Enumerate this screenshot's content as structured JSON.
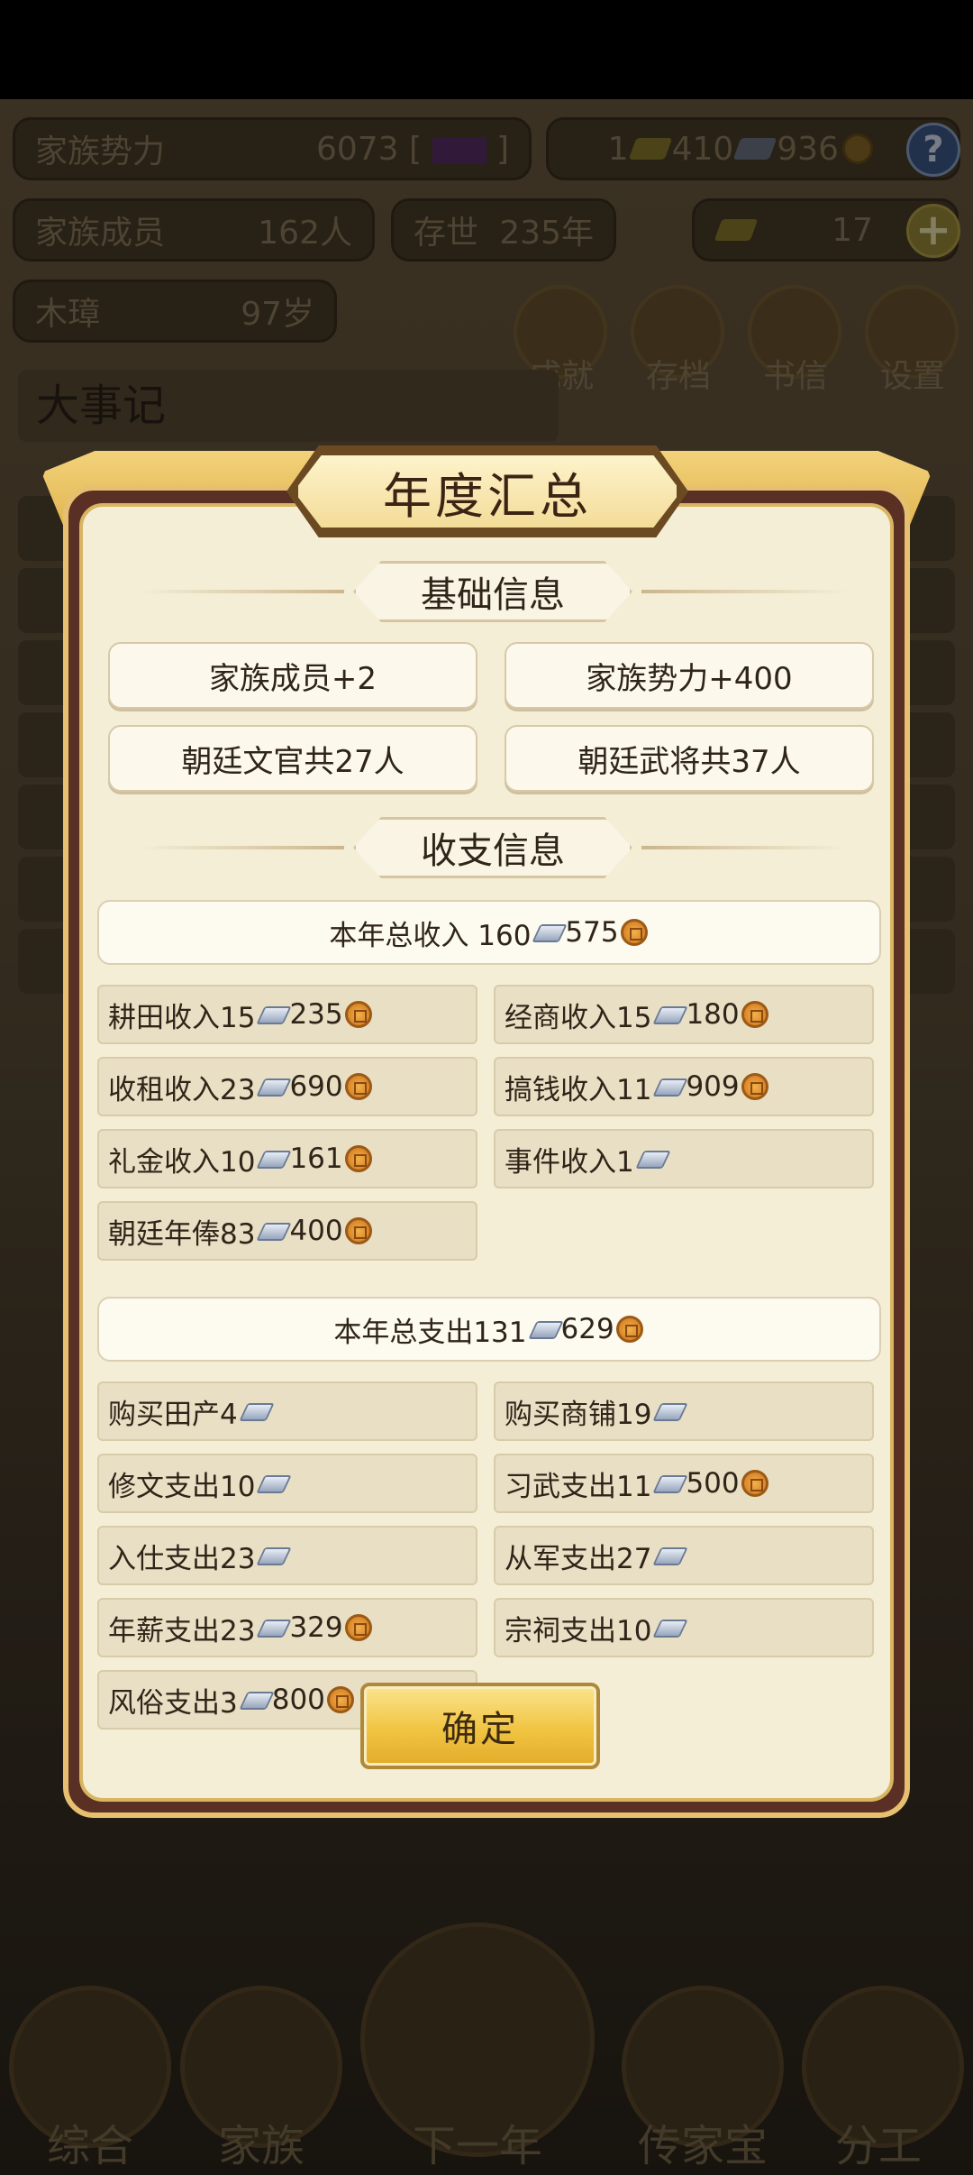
{
  "header": {
    "power_label": "家族势力",
    "power_value": "6073",
    "power_tag": "",
    "gold_ingots": "1",
    "silver": "410",
    "coins": "936",
    "members_label": "家族成员",
    "members_value": "162人",
    "years_label": "存世",
    "years_value": "235年",
    "yuanbao": "17",
    "patriarch_name": "木璋",
    "patriarch_age": "97岁"
  },
  "top_menu": [
    {
      "label": "成就"
    },
    {
      "label": "存档"
    },
    {
      "label": "书信"
    },
    {
      "label": "设置"
    }
  ],
  "events_title": "大事记",
  "bottom_nav": [
    {
      "label": "综合"
    },
    {
      "label": "家族"
    },
    {
      "label": "下一年"
    },
    {
      "label": "传家宝"
    },
    {
      "label": "分工"
    }
  ],
  "dialog": {
    "title": "年度汇总",
    "basic_section": "基础信息",
    "basic": [
      {
        "text": "家族成员+2"
      },
      {
        "text": "家族势力+400"
      },
      {
        "text": "朝廷文官共27人"
      },
      {
        "text": "朝廷武将共37人"
      }
    ],
    "finance_section": "收支信息",
    "income_total": {
      "label": "本年总收入 160",
      "coins": "575"
    },
    "income": [
      {
        "label": "耕田收入15",
        "coins": "235"
      },
      {
        "label": "经商收入15",
        "coins": "180"
      },
      {
        "label": "收租收入23",
        "coins": "690"
      },
      {
        "label": "搞钱收入11",
        "coins": "909"
      },
      {
        "label": "礼金收入10",
        "coins": "161"
      },
      {
        "label": "事件收入1",
        "coins": ""
      },
      {
        "label": "朝廷年俸83",
        "coins": "400"
      }
    ],
    "expense_total": {
      "label": "本年总支出131",
      "coins": "629"
    },
    "expense": [
      {
        "label": "购买田产4",
        "coins": ""
      },
      {
        "label": "购买商铺19",
        "coins": ""
      },
      {
        "label": "修文支出10",
        "coins": ""
      },
      {
        "label": "习武支出11",
        "coins": "500"
      },
      {
        "label": "入仕支出23",
        "coins": ""
      },
      {
        "label": "从军支出27",
        "coins": ""
      },
      {
        "label": "年薪支出23",
        "coins": "329"
      },
      {
        "label": "宗祠支出10",
        "coins": ""
      },
      {
        "label": "风俗支出3",
        "coins": "800"
      }
    ],
    "confirm_label": "确定"
  }
}
